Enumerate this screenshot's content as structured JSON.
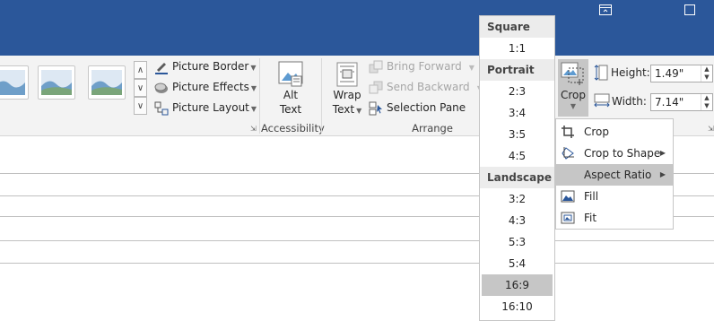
{
  "window": {
    "restore_icon": "ribbon-display-options-icon",
    "maximize_icon": "maximize-icon"
  },
  "colors": {
    "titlebar": "#2b579a",
    "ribbon": "#f3f3f3",
    "selected": "#c6c6c6"
  },
  "ribbon": {
    "picture_styles": {
      "picture_border": "Picture Border",
      "picture_effects": "Picture Effects",
      "picture_layout": "Picture Layout"
    },
    "accessibility": {
      "alt_text_line1": "Alt",
      "alt_text_line2": "Text",
      "group_label": "Accessibility"
    },
    "arrange": {
      "wrap_text_line1": "Wrap",
      "wrap_text_line2": "Text",
      "bring_forward": "Bring Forward",
      "send_backward": "Send Backward",
      "selection_pane": "Selection Pane",
      "group_label": "Arrange"
    },
    "size": {
      "crop": "Crop",
      "height_label": "Height:",
      "height_value": "1.49\"",
      "width_label": "Width:",
      "width_value": "7.14\""
    }
  },
  "crop_menu": {
    "items": [
      {
        "label": "Crop",
        "icon": "crop-icon"
      },
      {
        "label": "Crop to Shape",
        "icon": "crop-to-shape-icon"
      },
      {
        "label": "Aspect Ratio",
        "icon": "",
        "selected": true
      },
      {
        "label": "Fill",
        "icon": "fill-icon"
      },
      {
        "label": "Fit",
        "icon": "fit-icon"
      }
    ]
  },
  "aspect_ratio_menu": {
    "sections": [
      {
        "heading": "Square",
        "items": [
          "1:1"
        ]
      },
      {
        "heading": "Portrait",
        "items": [
          "2:3",
          "3:4",
          "3:5",
          "4:5"
        ]
      },
      {
        "heading": "Landscape",
        "items": [
          "3:2",
          "4:3",
          "5:3",
          "5:4",
          "16:9",
          "16:10"
        ]
      }
    ],
    "selected": "16:9"
  }
}
